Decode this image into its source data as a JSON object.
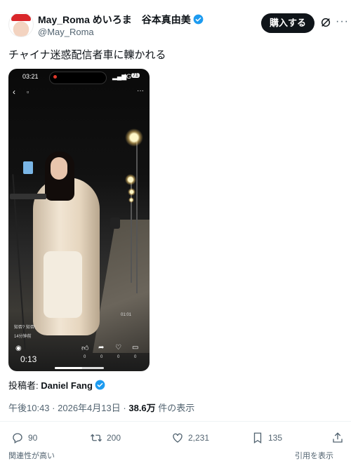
{
  "header": {
    "name": "May_Roma めいろま　谷本真由美",
    "handle": "@May_Roma",
    "buy_label": "購入する",
    "more_label": "···"
  },
  "tweet_text": "チャイナ迷惑配信者車に轢かれる",
  "video": {
    "time": "03:21",
    "signal": "4G",
    "battery": "71",
    "watermark_line1": "知否? 知否!",
    "watermark_line2": "14分钟前",
    "side_label": "01:01",
    "duration": "0:13",
    "counts": [
      "0",
      "0",
      "0",
      "0"
    ],
    "progress": 0.55
  },
  "posted_by": {
    "prefix": "投稿者:",
    "name": "Daniel Fang"
  },
  "meta": {
    "time": "午後10:43",
    "date": "2026年4月13日",
    "views": "38.6万",
    "views_suffix": "件の表示",
    "sep": "·"
  },
  "actions": {
    "replies": "90",
    "reposts": "200",
    "likes": "2,231",
    "bookmarks": "135"
  },
  "cut_off": {
    "left": "関連性が高い",
    "right": "引用を表示"
  },
  "colors": {
    "accent": "#1d9bf0",
    "text": "#0f1419",
    "secondary": "#536471"
  }
}
